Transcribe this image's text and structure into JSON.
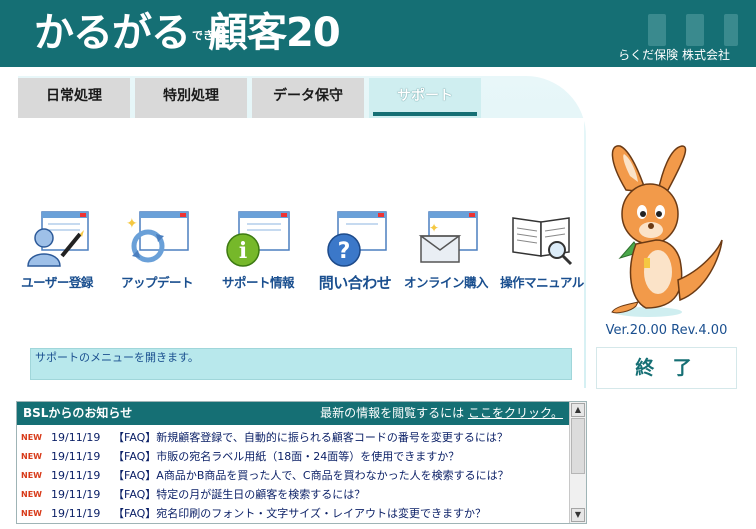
{
  "header": {
    "logo_main": "かるがる",
    "logo_small": "できる",
    "logo_product": "顧客20",
    "company": "らくだ保険 株式会社"
  },
  "tabs": [
    {
      "label": "日常処理",
      "active": false
    },
    {
      "label": "特別処理",
      "active": false
    },
    {
      "label": "データ保守",
      "active": false
    },
    {
      "label": "サポート",
      "active": true
    }
  ],
  "menu": [
    {
      "label": "ユーザー登録",
      "icon": "user-register-icon"
    },
    {
      "label": "アップデート",
      "icon": "update-icon"
    },
    {
      "label": "サポート情報",
      "icon": "support-info-icon"
    },
    {
      "label": "問い合わせ",
      "icon": "inquiry-icon"
    },
    {
      "label": "オンライン購入",
      "icon": "online-purchase-icon"
    },
    {
      "label": "操作マニュアル",
      "icon": "manual-icon"
    }
  ],
  "status_message": "サポートのメニューを開きます。",
  "news": {
    "title": "BSLからのお知らせ",
    "link_prefix": "最新の情報を閲覧するには",
    "link_text": "ここをクリック。",
    "badge": "NEW",
    "items": [
      {
        "date": "19/11/19",
        "text": "【FAQ】新規顧客登録で、自動的に振られる顧客コードの番号を変更するには？"
      },
      {
        "date": "19/11/19",
        "text": "【FAQ】市販の宛名ラベル用紙（18面・24面等）を使用できますか？"
      },
      {
        "date": "19/11/19",
        "text": "【FAQ】A商品かB商品を買った人で、C商品を買わなかった人を検索するには？"
      },
      {
        "date": "19/11/19",
        "text": "【FAQ】特定の月が誕生日の顧客を検索するには？"
      },
      {
        "date": "19/11/19",
        "text": "【FAQ】宛名印刷のフォント・文字サイズ・レイアウトは変更できますか？"
      }
    ]
  },
  "version": "Ver.20.00 Rev.4.00",
  "exit_label": "終 了",
  "colors": {
    "brand": "#156f74",
    "accent_text": "#1a4f8f",
    "panel_light": "#b8e8ec"
  }
}
